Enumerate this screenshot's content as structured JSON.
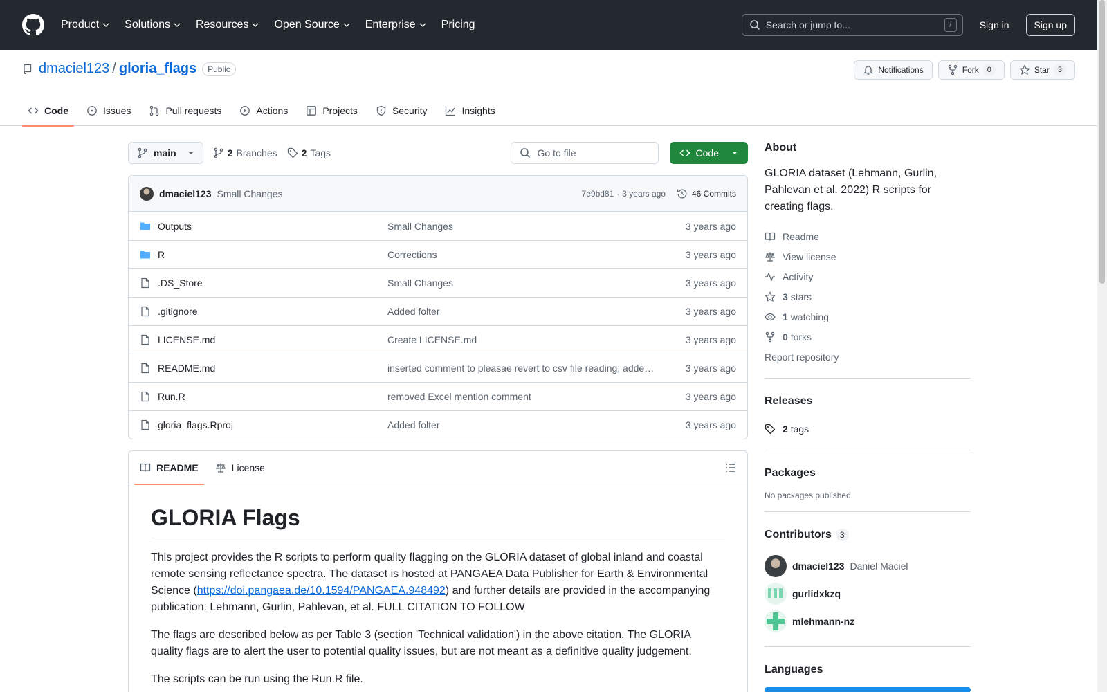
{
  "header": {
    "nav": [
      {
        "label": "Product",
        "has_menu": true
      },
      {
        "label": "Solutions",
        "has_menu": true
      },
      {
        "label": "Resources",
        "has_menu": true
      },
      {
        "label": "Open Source",
        "has_menu": true
      },
      {
        "label": "Enterprise",
        "has_menu": true
      },
      {
        "label": "Pricing",
        "has_menu": false
      }
    ],
    "search_placeholder": "Search or jump to...",
    "search_shortcut": "/",
    "sign_in": "Sign in",
    "sign_up": "Sign up"
  },
  "repo": {
    "owner": "dmaciel123",
    "separator": "/",
    "name": "gloria_flags",
    "visibility": "Public",
    "notifications_label": "Notifications",
    "fork_label": "Fork",
    "fork_count": "0",
    "star_label": "Star",
    "star_count": "3"
  },
  "tabs": [
    {
      "label": "Code",
      "icon": "code-icon",
      "active": true
    },
    {
      "label": "Issues",
      "icon": "issue-icon",
      "active": false
    },
    {
      "label": "Pull requests",
      "icon": "pull-request-icon",
      "active": false
    },
    {
      "label": "Actions",
      "icon": "play-icon",
      "active": false
    },
    {
      "label": "Projects",
      "icon": "table-icon",
      "active": false
    },
    {
      "label": "Security",
      "icon": "shield-icon",
      "active": false
    },
    {
      "label": "Insights",
      "icon": "graph-icon",
      "active": false
    }
  ],
  "toolbar": {
    "branch": "main",
    "branches_count": "2",
    "branches_label": "Branches",
    "tags_count": "2",
    "tags_label": "Tags",
    "goto_placeholder": "Go to file",
    "code_label": "Code"
  },
  "latest_commit": {
    "author": "dmaciel123",
    "message": "Small Changes",
    "hash": "7e9bd81",
    "dot": "·",
    "age": "3 years ago",
    "commits_label": "46 Commits"
  },
  "files": [
    {
      "name": "Outputs",
      "type": "folder",
      "message": "Small Changes",
      "age": "3 years ago"
    },
    {
      "name": "R",
      "type": "folder",
      "message": "Corrections",
      "age": "3 years ago"
    },
    {
      "name": ".DS_Store",
      "type": "file",
      "message": "Small Changes",
      "age": "3 years ago"
    },
    {
      "name": ".gitignore",
      "type": "file",
      "message": "Added folter",
      "age": "3 years ago"
    },
    {
      "name": "LICENSE.md",
      "type": "file",
      "message": "Create LICENSE.md",
      "age": "3 years ago"
    },
    {
      "name": "README.md",
      "type": "file",
      "message": "inserted comment to pleasae revert to csv file reading; added info on RStudio project",
      "age": "3 years ago"
    },
    {
      "name": "Run.R",
      "type": "file",
      "message": "removed Excel mention comment",
      "age": "3 years ago"
    },
    {
      "name": "gloria_flags.Rproj",
      "type": "file",
      "message": "Added folter",
      "age": "3 years ago"
    }
  ],
  "readme": {
    "tab_readme": "README",
    "tab_license": "License",
    "title": "GLORIA Flags",
    "p1_before": "This project provides the R scripts to perform quality flagging on the GLORIA dataset of global inland and coastal remote sensing reflectance spectra. The dataset is hosted at PANGAEA Data Publisher for Earth & Environmental Science (",
    "p1_link": "https://doi.pangaea.de/10.1594/PANGAEA.948492",
    "p1_after": ") and further details are provided in the accompanying publication: Lehmann, Gurlin, Pahlevan, et al. FULL CITATION TO FOLLOW",
    "p2": "The flags are described below as per Table 3 (section 'Technical validation') in the above citation. The GLORIA quality flags are to alert the user to potential quality issues, but are not meant as a definitive quality judgement.",
    "p3": "The scripts can be run using the Run.R file."
  },
  "about": {
    "title": "About",
    "description": "GLORIA dataset (Lehmann, Gurlin, Pahlevan et al. 2022) R scripts for creating flags.",
    "readme": "Readme",
    "license": "View license",
    "activity": "Activity",
    "stars_count": "3",
    "stars_label": "stars",
    "watching_count": "1",
    "watching_label": "watching",
    "forks_count": "0",
    "forks_label": "forks",
    "report": "Report repository"
  },
  "releases": {
    "title": "Releases",
    "tags_count": "2",
    "tags_label": "tags"
  },
  "packages": {
    "title": "Packages",
    "empty": "No packages published"
  },
  "contributors": {
    "title": "Contributors",
    "count": "3",
    "list": [
      {
        "login": "dmaciel123",
        "name": "Daniel Maciel"
      },
      {
        "login": "gurlidxkzq",
        "name": ""
      },
      {
        "login": "mlehmann-nz",
        "name": ""
      }
    ]
  },
  "languages": {
    "title": "Languages",
    "bar_color": "#198CE7",
    "share": 1.0
  },
  "colors": {
    "header_bg": "#24292f",
    "link": "#0969da",
    "primary_button": "#1f883d",
    "tab_underline": "#fd8c73"
  }
}
